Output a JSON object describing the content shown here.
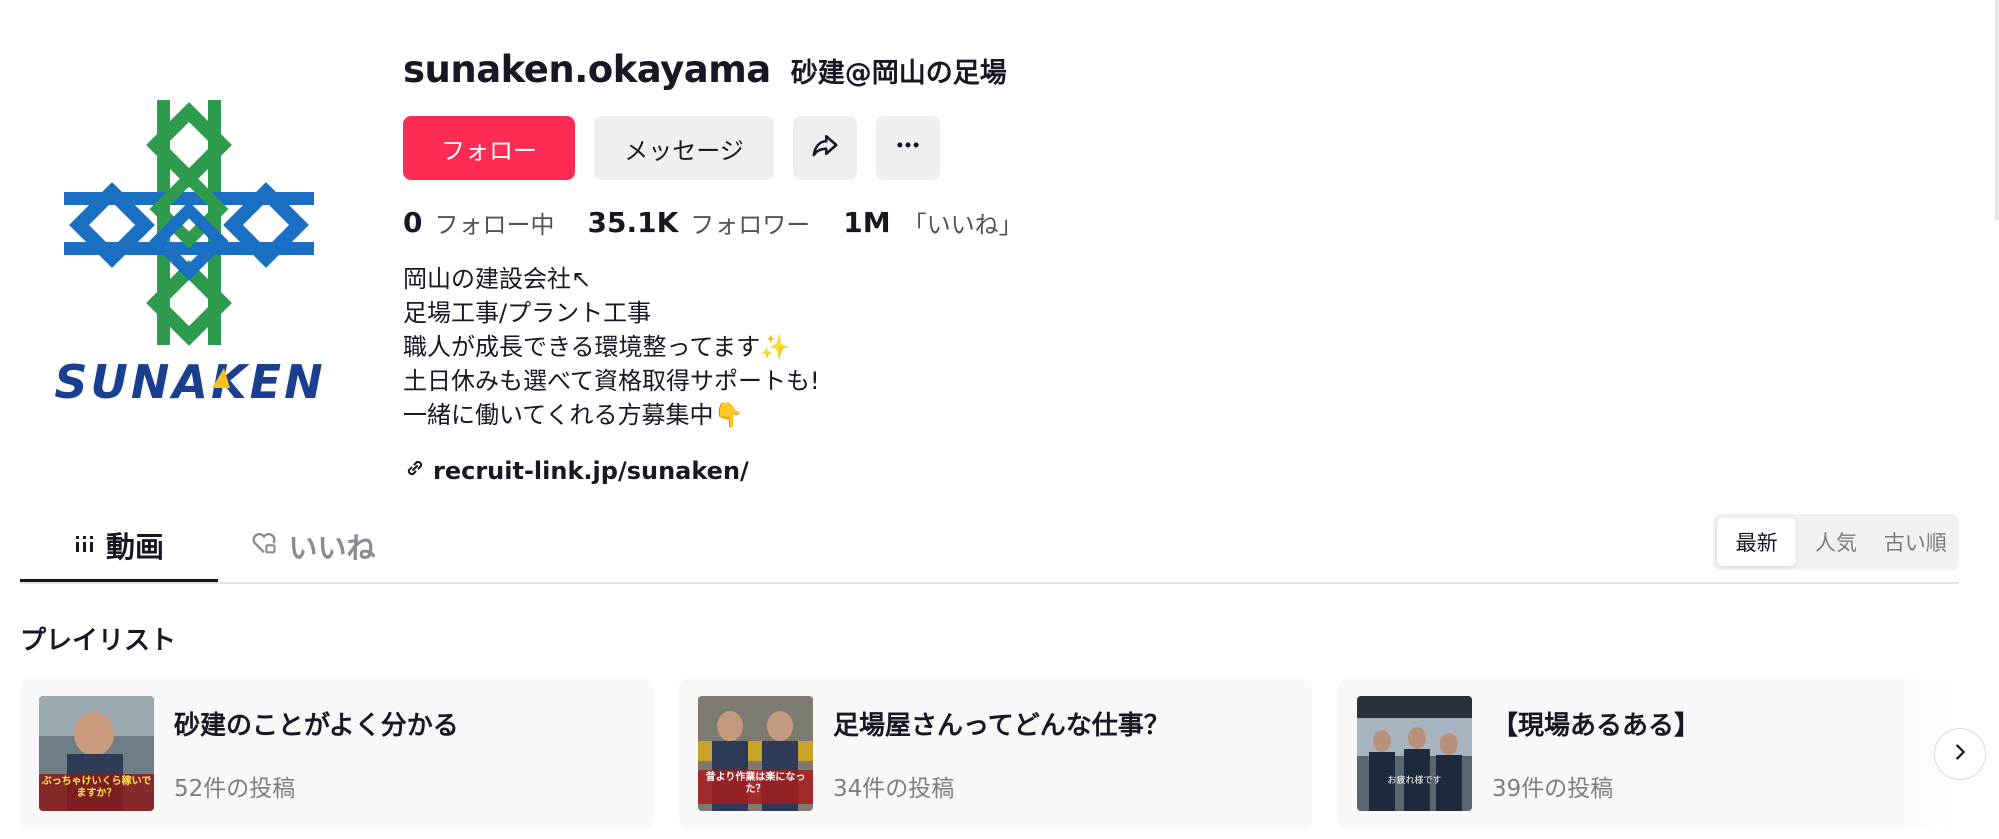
{
  "profile": {
    "username": "sunaken.okayama",
    "nickname": "砂建@岡山の足場",
    "avatar_logo_text": "SUNAKEN",
    "follow_label": "フォロー",
    "message_label": "メッセージ",
    "share_icon": "share-icon",
    "more_icon": "more-icon"
  },
  "stats": [
    {
      "value": "0",
      "label": "フォロー中"
    },
    {
      "value": "35.1K",
      "label": "フォロワー"
    },
    {
      "value": "1M",
      "label": "「いいね」"
    }
  ],
  "bio": [
    "岡山の建設会社↖",
    "足場工事/プラント工事",
    "職人が成長できる環境整ってます✨",
    "土日休みも選べて資格取得サポートも!",
    "一緒に働いてくれる方募集中👇"
  ],
  "link": "recruit-link.jp/sunaken/",
  "tabs": {
    "videos_label": "動画",
    "liked_label": "いいね"
  },
  "sort": {
    "options": [
      "最新",
      "人気",
      "古い順"
    ],
    "selected": "最新"
  },
  "playlists": {
    "title": "プレイリスト",
    "items": [
      {
        "title": "砂建のことがよく分かる",
        "count": "52件の投稿",
        "thumb_caption": "ぶっちゃけいくら稼いでますか？"
      },
      {
        "title": "足場屋さんってどんな仕事？",
        "count": "34件の投稿",
        "thumb_caption": "昔より作業は楽になった？"
      },
      {
        "title": "【現場あるある】",
        "count": "39件の投稿",
        "thumb_caption": "お疲れ様です"
      }
    ]
  },
  "colors": {
    "accent": "#fe2c55",
    "logo_green": "#2e9b4e",
    "logo_blue": "#1b6fc2",
    "logo_navy": "#1a3f8f"
  }
}
